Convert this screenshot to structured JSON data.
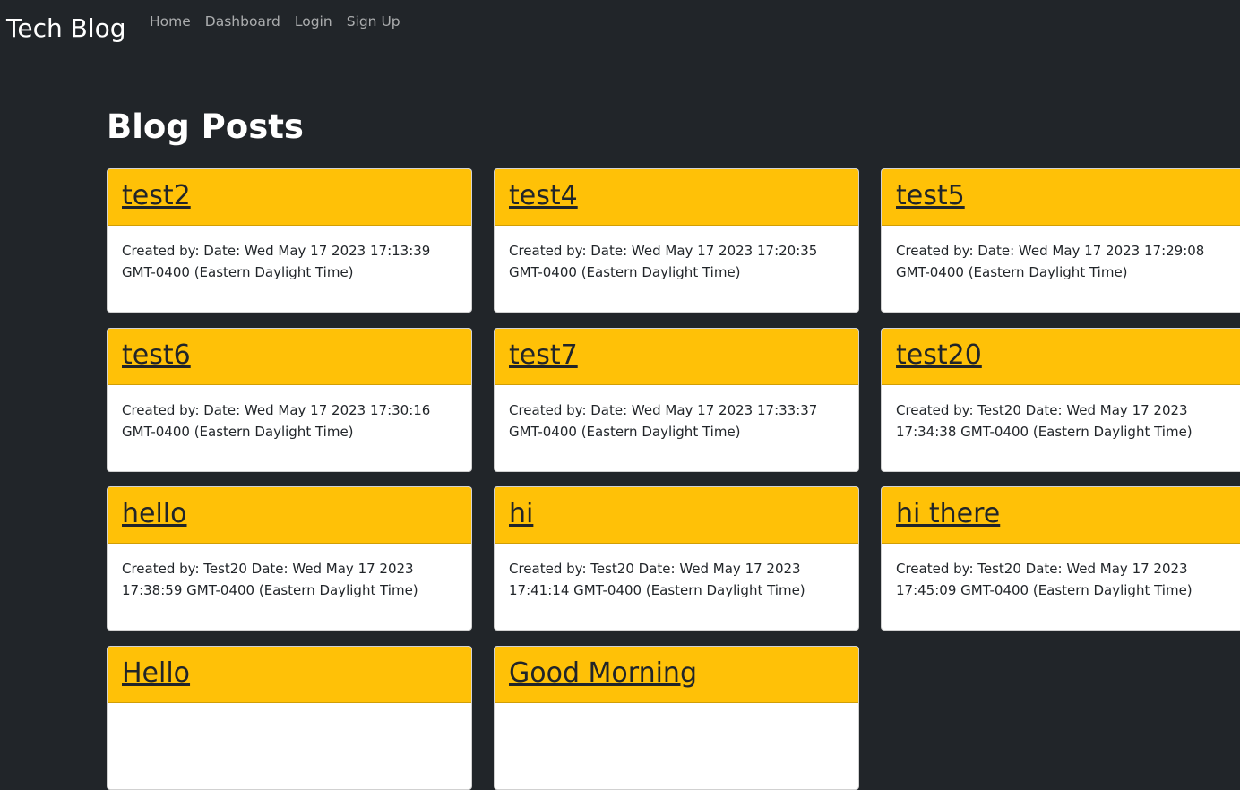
{
  "navbar": {
    "brand": "Tech Blog",
    "links": [
      "Home",
      "Dashboard",
      "Login",
      "Sign Up"
    ]
  },
  "main": {
    "title": "Blog Posts",
    "posts": [
      {
        "title": "test2",
        "meta": "Created by: Date: Wed May 17 2023 17:13:39 GMT-0400 (Eastern Daylight Time)"
      },
      {
        "title": "test4",
        "meta": "Created by: Date: Wed May 17 2023 17:20:35 GMT-0400 (Eastern Daylight Time)"
      },
      {
        "title": "test5",
        "meta": "Created by: Date: Wed May 17 2023 17:29:08 GMT-0400 (Eastern Daylight Time)"
      },
      {
        "title": "test6",
        "meta": "Created by: Date: Wed May 17 2023 17:30:16 GMT-0400 (Eastern Daylight Time)"
      },
      {
        "title": "test7",
        "meta": "Created by: Date: Wed May 17 2023 17:33:37 GMT-0400 (Eastern Daylight Time)"
      },
      {
        "title": "test20",
        "meta": "Created by: Test20 Date: Wed May 17 2023 17:34:38 GMT-0400 (Eastern Daylight Time)"
      },
      {
        "title": "hello",
        "meta": "Created by: Test20 Date: Wed May 17 2023 17:38:59 GMT-0400 (Eastern Daylight Time)"
      },
      {
        "title": "hi",
        "meta": "Created by: Test20 Date: Wed May 17 2023 17:41:14 GMT-0400 (Eastern Daylight Time)"
      },
      {
        "title": "hi there",
        "meta": "Created by: Test20 Date: Wed May 17 2023 17:45:09 GMT-0400 (Eastern Daylight Time)"
      },
      {
        "title": "Hello",
        "meta": ""
      },
      {
        "title": "Good Morning",
        "meta": ""
      }
    ]
  }
}
